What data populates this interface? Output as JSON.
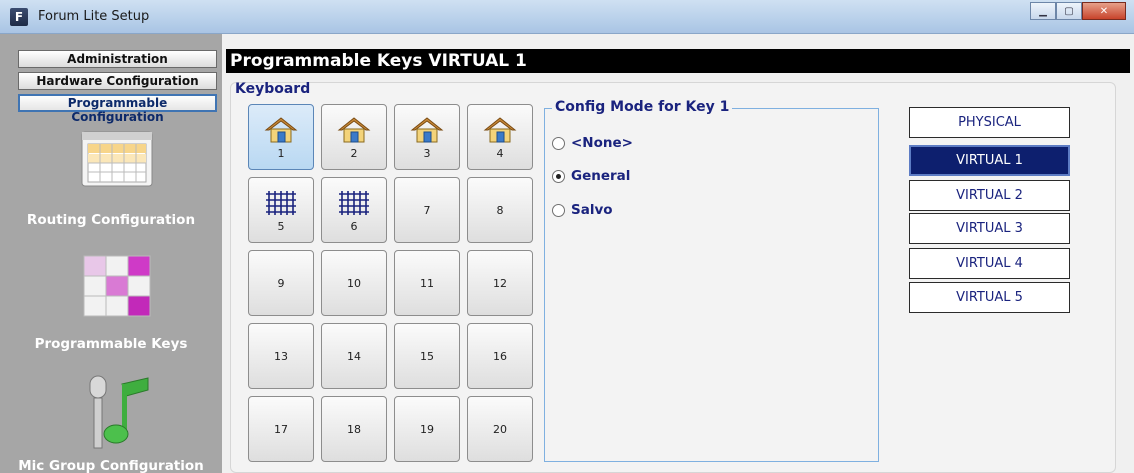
{
  "window": {
    "title": "Forum Lite Setup",
    "app_icon_letter": "F"
  },
  "sidebar": {
    "nav": [
      "Administration",
      "Hardware Configuration",
      "Programmable Configuration"
    ],
    "active_nav": "Programmable Configuration",
    "sections": [
      "Routing Configuration",
      "Programmable Keys",
      "Mic Group Configuration"
    ]
  },
  "main": {
    "title": "Programmable Keys VIRTUAL  1",
    "keyboard_label": "Keyboard",
    "keys": [
      {
        "label": "1",
        "icon": "house-icon",
        "selected": true
      },
      {
        "label": "2",
        "icon": "house-icon"
      },
      {
        "label": "3",
        "icon": "house-icon"
      },
      {
        "label": "4",
        "icon": "house-icon"
      },
      {
        "label": "5",
        "icon": "grid-icon"
      },
      {
        "label": "6",
        "icon": "grid-icon"
      },
      {
        "label": "7"
      },
      {
        "label": "8"
      },
      {
        "label": "9"
      },
      {
        "label": "10"
      },
      {
        "label": "11"
      },
      {
        "label": "12"
      },
      {
        "label": "13"
      },
      {
        "label": "14"
      },
      {
        "label": "15"
      },
      {
        "label": "16"
      },
      {
        "label": "17"
      },
      {
        "label": "18"
      },
      {
        "label": "19"
      },
      {
        "label": "20"
      }
    ],
    "config_group": {
      "title": "Config Mode for Key 1",
      "options": [
        "<None>",
        "General",
        "Salvo"
      ],
      "selected": "General"
    },
    "virtual_buttons": [
      "PHYSICAL",
      "VIRTUAL 1",
      "VIRTUAL 2",
      "VIRTUAL 3",
      "VIRTUAL 4",
      "VIRTUAL 5"
    ],
    "selected_virtual": "VIRTUAL 1"
  }
}
